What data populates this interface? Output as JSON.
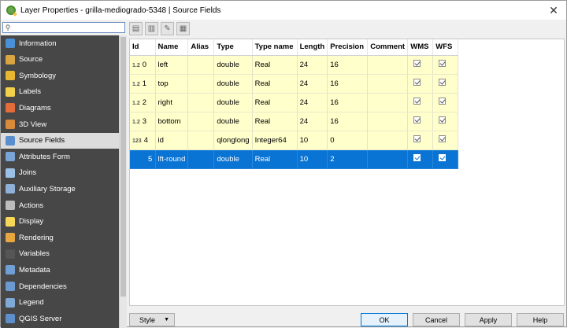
{
  "window": {
    "title": "Layer Properties - grilla-mediogrado-5348 | Source Fields",
    "close_glyph": "✕"
  },
  "search": {
    "value": "",
    "placeholder": ""
  },
  "sidebar": {
    "items": [
      {
        "label": "Information",
        "icon": "info-icon",
        "color": "#4a90d9"
      },
      {
        "label": "Source",
        "icon": "gear-source-icon",
        "color": "#d9a441"
      },
      {
        "label": "Symbology",
        "icon": "brush-icon",
        "color": "#e8b630"
      },
      {
        "label": "Labels",
        "icon": "abc-label-icon",
        "color": "#f3d04b"
      },
      {
        "label": "Diagrams",
        "icon": "diagram-icon",
        "color": "#e46c3a"
      },
      {
        "label": "3D View",
        "icon": "cube-icon",
        "color": "#d98a3a"
      },
      {
        "label": "Source Fields",
        "icon": "table-icon",
        "color": "#5a8fcf"
      },
      {
        "label": "Attributes Form",
        "icon": "form-icon",
        "color": "#7aa3d8"
      },
      {
        "label": "Joins",
        "icon": "join-icon",
        "color": "#9bc2e6"
      },
      {
        "label": "Auxiliary Storage",
        "icon": "storage-icon",
        "color": "#8fb1d8"
      },
      {
        "label": "Actions",
        "icon": "gear-actions-icon",
        "color": "#bcbcbc"
      },
      {
        "label": "Display",
        "icon": "speech-bubble-icon",
        "color": "#f6d757"
      },
      {
        "label": "Rendering",
        "icon": "paintbrush-icon",
        "color": "#e8a640"
      },
      {
        "label": "Variables",
        "icon": "variable-icon",
        "color": "#555555"
      },
      {
        "label": "Metadata",
        "icon": "metadata-icon",
        "color": "#6f9fd4"
      },
      {
        "label": "Dependencies",
        "icon": "dependency-icon",
        "color": "#6a9ad0"
      },
      {
        "label": "Legend",
        "icon": "legend-icon",
        "color": "#7fa9d6"
      },
      {
        "label": "QGIS Server",
        "icon": "server-icon",
        "color": "#5d8fca"
      }
    ],
    "active_index": 6
  },
  "toolbar": {
    "buttons": [
      {
        "icon": "new-field-icon",
        "glyph": "▤"
      },
      {
        "icon": "delete-field-icon",
        "glyph": "▥"
      },
      {
        "icon": "edit-pencil-icon",
        "glyph": "✎"
      },
      {
        "icon": "field-calculator-icon",
        "glyph": "▦"
      }
    ]
  },
  "table": {
    "columns": [
      "Id",
      "Name",
      "Alias",
      "Type",
      "Type name",
      "Length",
      "Precision",
      "Comment",
      "WMS",
      "WFS"
    ],
    "rows": [
      {
        "type_icon": "1.2",
        "id": "0",
        "name": "left",
        "alias": "",
        "type": "double",
        "type_name": "Real",
        "length": "24",
        "precision": "16",
        "comment": "",
        "wms": true,
        "wfs": true
      },
      {
        "type_icon": "1.2",
        "id": "1",
        "name": "top",
        "alias": "",
        "type": "double",
        "type_name": "Real",
        "length": "24",
        "precision": "16",
        "comment": "",
        "wms": true,
        "wfs": true
      },
      {
        "type_icon": "1.2",
        "id": "2",
        "name": "right",
        "alias": "",
        "type": "double",
        "type_name": "Real",
        "length": "24",
        "precision": "16",
        "comment": "",
        "wms": true,
        "wfs": true
      },
      {
        "type_icon": "1.2",
        "id": "3",
        "name": "bottom",
        "alias": "",
        "type": "double",
        "type_name": "Real",
        "length": "24",
        "precision": "16",
        "comment": "",
        "wms": true,
        "wfs": true
      },
      {
        "type_icon": "123",
        "id": "4",
        "name": "id",
        "alias": "",
        "type": "qlonglong",
        "type_name": "Integer64",
        "length": "10",
        "precision": "0",
        "comment": "",
        "wms": true,
        "wfs": true
      },
      {
        "type_icon": "",
        "id": "5",
        "name": "lft-round",
        "alias": "",
        "type": "double",
        "type_name": "Real",
        "length": "10",
        "precision": "2",
        "comment": "",
        "wms": true,
        "wfs": true,
        "selected": true
      }
    ]
  },
  "footer": {
    "style_label": "Style",
    "ok_label": "OK",
    "cancel_label": "Cancel",
    "apply_label": "Apply",
    "help_label": "Help"
  },
  "colors": {
    "sidebar_bg": "#474747",
    "row_bg": "#ffffcc",
    "selected_row": "#0a74d4",
    "primary_border": "#0078d7"
  }
}
